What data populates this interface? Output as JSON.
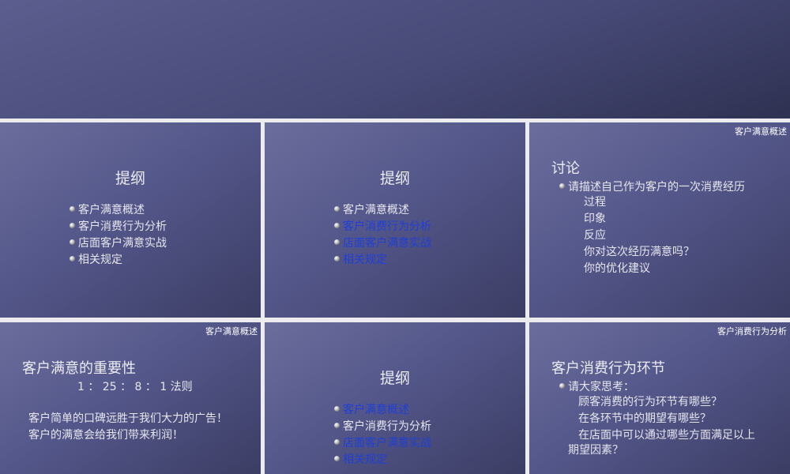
{
  "corner_labels": {
    "s3": "客户满意概述",
    "s4": "客户满意概述",
    "s6": "客户消费行为分析"
  },
  "outline": {
    "title": "提纲",
    "items": [
      "客户满意概述",
      "客户消费行为分析",
      "店面客户满意实战",
      "相关规定"
    ]
  },
  "discussion": {
    "title": "讨论",
    "prompt": "请描述自己作为客户的一次消费经历",
    "points": [
      "过程",
      "印象",
      "反应",
      "你对这次经历满意吗？",
      "你的优化建议"
    ]
  },
  "importance": {
    "title": "客户满意的重要性",
    "rule": "1 ： 25 ： 8 ： 1  法则",
    "lines": [
      "客户简单的口碑远胜于我们大力的广告！",
      "客户的满意会给我们带来利润！"
    ]
  },
  "consumption": {
    "title": "客户消费行为环节",
    "prompt": "请大家思考：",
    "questions": [
      "顾客消费的行为环节有哪些？",
      "在各环节中的期望有哪些？",
      "在店面中可以通过哪些方面满足以上"
    ],
    "continuation": "期望因素？"
  },
  "colors": {
    "highlight": "#1f3fd6"
  }
}
